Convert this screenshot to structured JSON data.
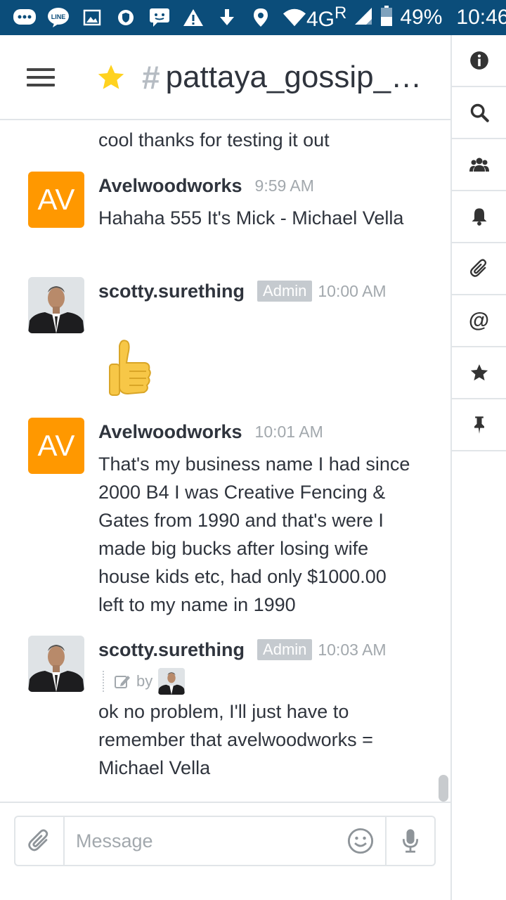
{
  "status_bar": {
    "icons": [
      "chat-bubble-icon",
      "line-app-icon",
      "image-icon",
      "shield-icon",
      "message-icon",
      "warning-icon",
      "download-icon",
      "location-icon",
      "wifi-icon",
      "signal-icon",
      "battery-icon"
    ],
    "network": "4G",
    "network_sup": "R",
    "battery": "49%",
    "time": "10:46"
  },
  "header": {
    "hash": "#",
    "room_name": "pattaya_gossip_r..."
  },
  "tabbar": {
    "at_symbol": "@",
    "items": [
      "info-icon",
      "search-icon",
      "members-icon",
      "notifications-icon",
      "files-icon",
      "mentions-icon",
      "starred-icon",
      "pinned-icon"
    ]
  },
  "messages": {
    "continuation": "cool thanks for testing it out",
    "list": [
      {
        "avatar_initials": "AV",
        "username": "Avelwoodworks",
        "time": "9:59 AM",
        "text": "Hahaha 555 It's Mick - Michael Vella"
      },
      {
        "username": "scotty.surething",
        "role": "Admin",
        "time": "10:00 AM",
        "emoji": "👍"
      },
      {
        "avatar_initials": "AV",
        "username": "Avelwoodworks",
        "time": "10:01 AM",
        "text": "That's my business name I had since 2000 B4 I was Creative Fencing & Gates from 1990 and that's were I made big bucks after losing wife house kids etc, had only $1000.00 left to my name in 1990"
      },
      {
        "username": "scotty.surething",
        "role": "Admin",
        "time": "10:03 AM",
        "edited_by": "by",
        "text": "ok no problem, I'll just have to remember that avelwoodworks = Michael Vella"
      }
    ]
  },
  "composer": {
    "placeholder": "Message"
  },
  "colors": {
    "status_bar": "#0b4d7a",
    "avatar_orange": "#ff9800",
    "star": "#ffd21f",
    "role_badge": "#c5cacf"
  }
}
